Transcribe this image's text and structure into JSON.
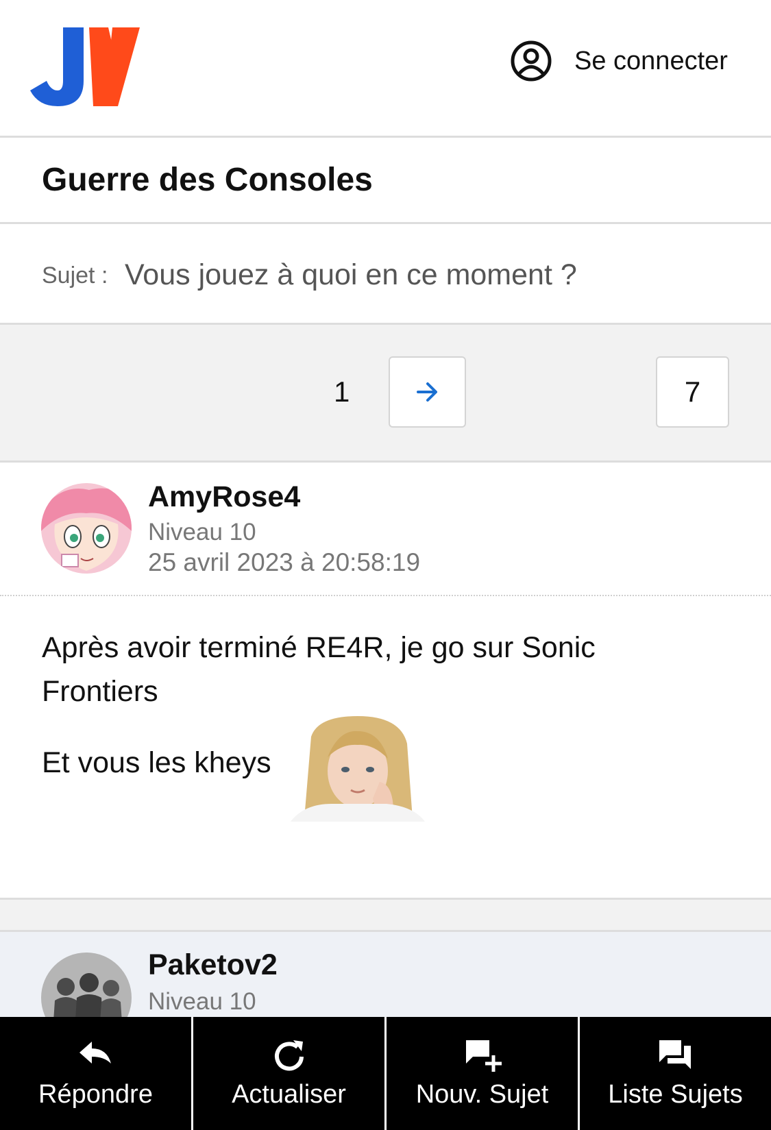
{
  "header": {
    "logo": {
      "text": "JV",
      "icon": "jv-logo",
      "colors": {
        "j": "#1f5fd6",
        "v": "#ff4a1a"
      }
    },
    "login": {
      "label": "Se connecter",
      "icon": "user-circle-icon"
    }
  },
  "forum": {
    "title": "Guerre des Consoles"
  },
  "topic": {
    "prefix": "Sujet :",
    "title": "Vous jouez à quoi en ce moment ?"
  },
  "pagination": {
    "current_page": "1",
    "next_icon": "arrow-right-icon",
    "last_page": "7",
    "accent": "#1a6fd1"
  },
  "posts": [
    {
      "author": "AmyRose4",
      "level": "Niveau 10",
      "date": "25 avril 2023 à 20:58:19",
      "avatar": "amy-rose-avatar",
      "lines": [
        "Après avoir terminé RE4R, je go sur Sonic",
        "Frontiers",
        "Et vous les kheys"
      ],
      "sticker": "blonde-girl-sticker"
    },
    {
      "author": "Paketov2",
      "level": "Niveau 10",
      "avatar": "silhouettes-avatar"
    }
  ],
  "toolbar": {
    "items": [
      {
        "label": "Répondre",
        "icon": "reply-icon"
      },
      {
        "label": "Actualiser",
        "icon": "refresh-icon"
      },
      {
        "label": "Nouv. Sujet",
        "icon": "new-topic-icon"
      },
      {
        "label": "Liste Sujets",
        "icon": "topic-list-icon"
      }
    ]
  }
}
